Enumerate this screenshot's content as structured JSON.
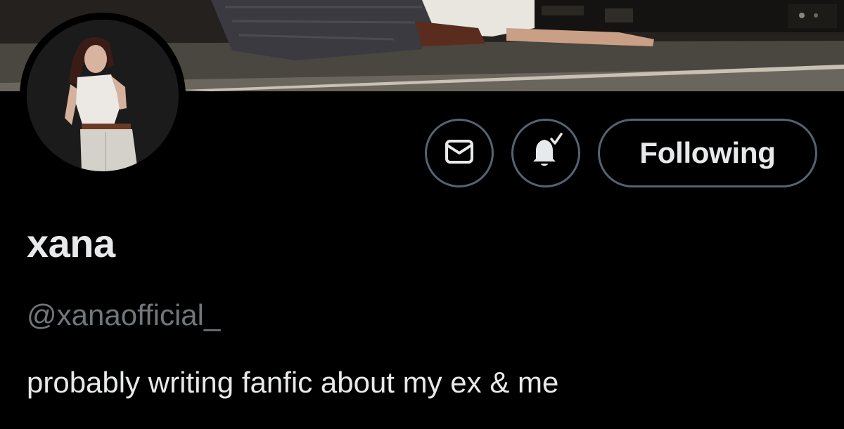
{
  "profile": {
    "display_name": "xana",
    "handle": "@xanaofficial_",
    "bio": "probably writing fanfic about my ex & me"
  },
  "actions": {
    "message_icon": "envelope-icon",
    "notify_icon": "bell-check-icon",
    "follow_label": "Following"
  },
  "colors": {
    "background": "#000000",
    "primary_text": "#e7e9ea",
    "secondary_text": "#71767b",
    "button_border": "#536471"
  }
}
